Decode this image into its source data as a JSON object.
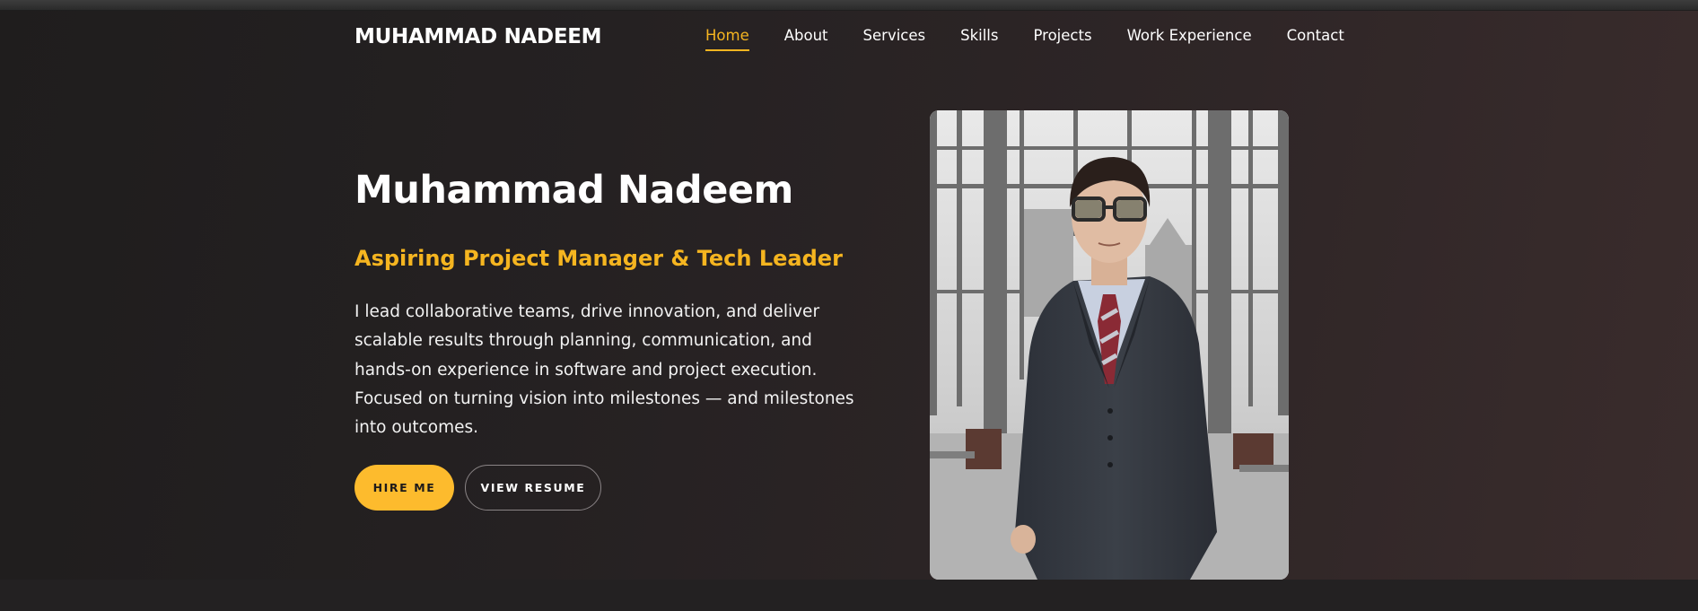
{
  "brand": "MUHAMMAD NADEEM",
  "nav": {
    "items": [
      "Home",
      "About",
      "Services",
      "Skills",
      "Projects",
      "Work Experience",
      "Contact"
    ],
    "active": "Home"
  },
  "hero": {
    "name": "Muhammad Nadeem",
    "role": "Aspiring Project Manager & Tech Leader",
    "description": "I lead collaborative teams, drive innovation, and deliver scalable results through planning, communication, and hands-on experience in software and project execution. Focused on turning vision into milestones — and milestones into outcomes.",
    "hire_label": "HIRE ME",
    "resume_label": "VIEW RESUME"
  },
  "colors": {
    "accent": "#f5b520",
    "button_primary": "#fdbb2d",
    "background": "#2a2627"
  }
}
